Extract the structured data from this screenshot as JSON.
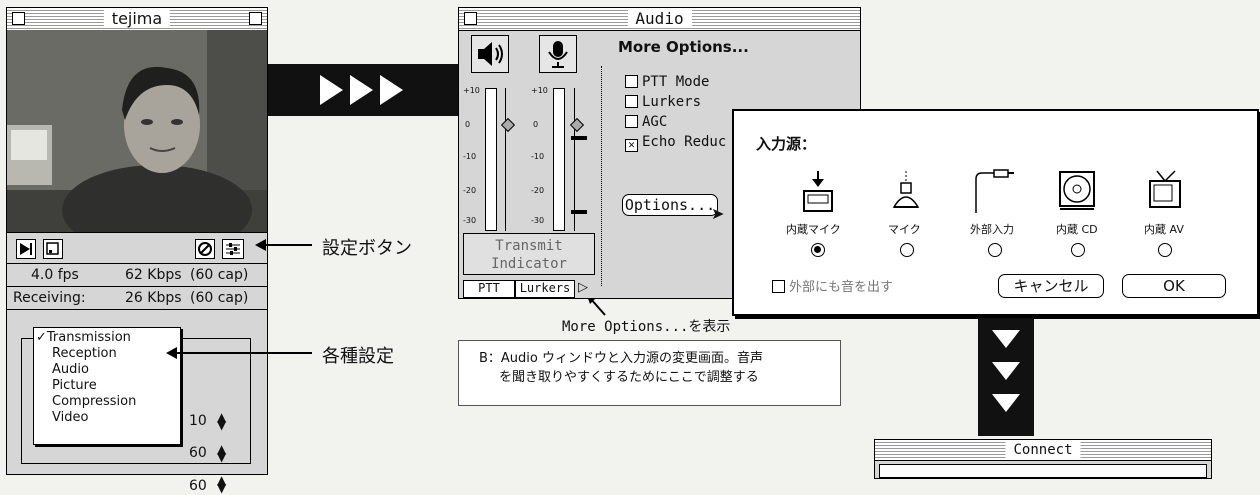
{
  "tejima": {
    "title": "tejima",
    "stats": {
      "fps": "4.0 fps",
      "kbps": "62 Kbps",
      "cap1": "(60 cap)",
      "receiving_label": "Receiving:",
      "recv_kbps": "26 Kbps",
      "cap2": "(60 cap)"
    },
    "menu": {
      "items": [
        "Transmission",
        "Reception",
        "Audio",
        "Picture",
        "Compression",
        "Video"
      ],
      "checked": "Transmission"
    },
    "values": [
      "10",
      "60",
      "60"
    ]
  },
  "callouts": {
    "settings_button": "設定ボタン",
    "various_settings": "各種設定",
    "more_options": "More Options...を表示"
  },
  "audio": {
    "title": "Audio",
    "more_options": "More Options...",
    "checkboxes": [
      {
        "label": "PTT Mode",
        "checked": false
      },
      {
        "label": "Lurkers",
        "checked": false
      },
      {
        "label": "AGC",
        "checked": false
      },
      {
        "label": "Echo Reduc",
        "checked": true
      }
    ],
    "options_button": "Options...",
    "scale": [
      "+10",
      "0",
      "-10",
      "-20",
      "-30"
    ],
    "transmit_indicator": "Transmit\nIndicator",
    "tabs": [
      "PTT",
      "Lurkers"
    ]
  },
  "input_source": {
    "title": "入力源：",
    "sources": [
      {
        "label": "内蔵マイク",
        "icon": "builtin-mic-icon",
        "selected": true
      },
      {
        "label": "マイク",
        "icon": "mic-icon",
        "selected": false
      },
      {
        "label": "外部入力",
        "icon": "external-jack-icon",
        "selected": false
      },
      {
        "label": "内蔵 CD",
        "icon": "cd-icon",
        "selected": false
      },
      {
        "label": "内蔵 AV",
        "icon": "tv-icon",
        "selected": false
      }
    ],
    "external_checkbox": "外部にも音を出す",
    "cancel": "キャンセル",
    "ok": "OK"
  },
  "caption": {
    "line1": "B：Audio ウィンドウと入力源の変更画面。音声",
    "line2": "を聞き取りやすくするためにここで調整する"
  },
  "connect": {
    "title": "Connect"
  }
}
